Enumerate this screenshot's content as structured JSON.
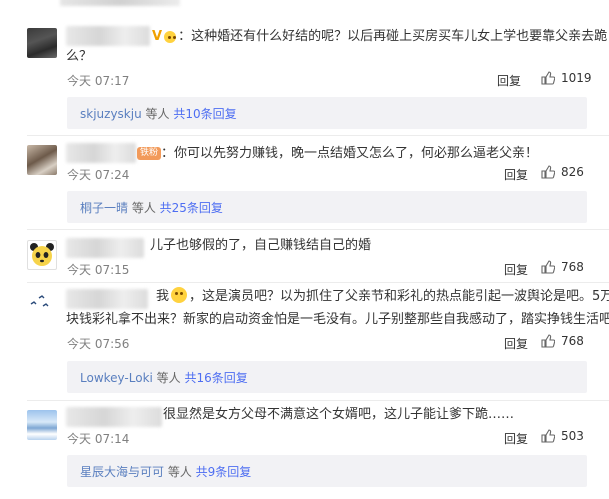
{
  "comments": [
    {
      "text_prefix_badge": "V",
      "text_line1": "：这种婚还有什么好结的呢？以后再碰上买房买车儿女上学也要靠父亲去跪",
      "text_line2": "么？",
      "time": "今天 07:17",
      "reply": "回复",
      "likes": "1019",
      "sub": {
        "who": "skjuzyskju",
        "rest": " 等人",
        "count": " 共10条回复"
      }
    },
    {
      "badge": "铁粉",
      "text": "：你可以先努力赚钱，晚一点结婚又怎么了，何必那么逼老父亲！",
      "time": "今天 07:24",
      "reply": "回复",
      "likes": "826",
      "sub": {
        "who": "桐子一晴",
        "rest": " 等人",
        "count": " 共25条回复"
      }
    },
    {
      "text": "儿子也够假的了，自己赚钱结自己的婚",
      "time": "今天 07:15",
      "reply": "回复",
      "likes": "768"
    },
    {
      "text_line1_a": "我",
      "text_line1_b": "，这是演员吧？以为抓住了父亲节和彩礼的热点能引起一波舆论是吧。5万",
      "text_line2": "块钱彩礼拿不出来？新家的启动资金怕是一毛没有。儿子别整那些自我感动了，踏实挣钱生活吧",
      "time": "今天 07:56",
      "reply": "回复",
      "likes": "768",
      "sub": {
        "who": "Lowkey-Loki",
        "rest": " 等人",
        "count": " 共16条回复"
      }
    },
    {
      "text": "很显然是女方父母不满意这个女婿吧，这儿子能让爹下跪……",
      "time": "今天 07:14",
      "reply": "回复",
      "likes": "503",
      "sub": {
        "who": "星辰大海与可可",
        "rest": " 等人",
        "count": " 共9条回复"
      }
    }
  ]
}
